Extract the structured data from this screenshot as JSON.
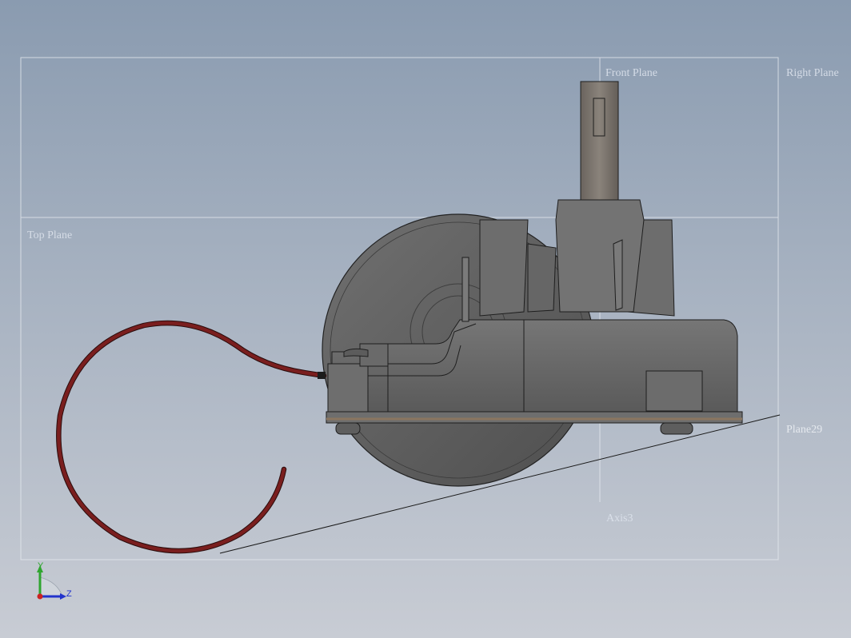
{
  "scene": {
    "planes": {
      "front": "Front Plane",
      "right": "Right Plane",
      "top": "Top Plane",
      "custom": "Plane29",
      "axis": "Axis3"
    },
    "colors": {
      "background_top": "#8a9bb0",
      "background_bottom": "#c8ccd4",
      "body": "#6b6b6b",
      "wheel": "#616161",
      "shaft": "#7a746d",
      "base_plate": "#8a7560",
      "cable": "#7a1e1e"
    }
  },
  "triad": {
    "y_label": "Y",
    "z_label": "Z",
    "colors": {
      "y": "#2fa52f",
      "z": "#2233cc",
      "x": "#cc2222"
    }
  }
}
